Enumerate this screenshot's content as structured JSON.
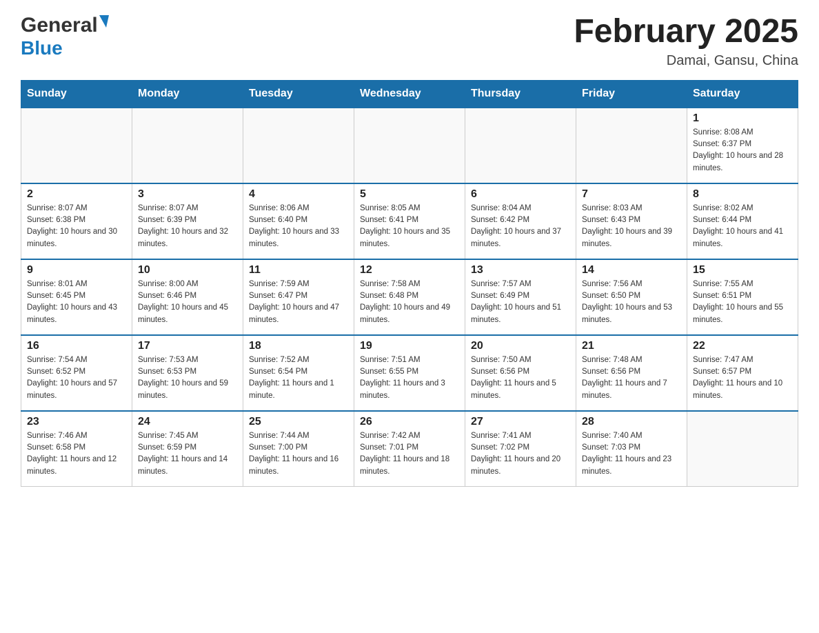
{
  "header": {
    "month_title": "February 2025",
    "location": "Damai, Gansu, China",
    "logo_general": "General",
    "logo_blue": "Blue"
  },
  "days_of_week": [
    "Sunday",
    "Monday",
    "Tuesday",
    "Wednesday",
    "Thursday",
    "Friday",
    "Saturday"
  ],
  "weeks": [
    {
      "days": [
        {
          "date": "",
          "sunrise": "",
          "sunset": "",
          "daylight": "",
          "empty": true
        },
        {
          "date": "",
          "sunrise": "",
          "sunset": "",
          "daylight": "",
          "empty": true
        },
        {
          "date": "",
          "sunrise": "",
          "sunset": "",
          "daylight": "",
          "empty": true
        },
        {
          "date": "",
          "sunrise": "",
          "sunset": "",
          "daylight": "",
          "empty": true
        },
        {
          "date": "",
          "sunrise": "",
          "sunset": "",
          "daylight": "",
          "empty": true
        },
        {
          "date": "",
          "sunrise": "",
          "sunset": "",
          "daylight": "",
          "empty": true
        },
        {
          "date": "1",
          "sunrise": "Sunrise: 8:08 AM",
          "sunset": "Sunset: 6:37 PM",
          "daylight": "Daylight: 10 hours and 28 minutes.",
          "empty": false
        }
      ]
    },
    {
      "days": [
        {
          "date": "2",
          "sunrise": "Sunrise: 8:07 AM",
          "sunset": "Sunset: 6:38 PM",
          "daylight": "Daylight: 10 hours and 30 minutes.",
          "empty": false
        },
        {
          "date": "3",
          "sunrise": "Sunrise: 8:07 AM",
          "sunset": "Sunset: 6:39 PM",
          "daylight": "Daylight: 10 hours and 32 minutes.",
          "empty": false
        },
        {
          "date": "4",
          "sunrise": "Sunrise: 8:06 AM",
          "sunset": "Sunset: 6:40 PM",
          "daylight": "Daylight: 10 hours and 33 minutes.",
          "empty": false
        },
        {
          "date": "5",
          "sunrise": "Sunrise: 8:05 AM",
          "sunset": "Sunset: 6:41 PM",
          "daylight": "Daylight: 10 hours and 35 minutes.",
          "empty": false
        },
        {
          "date": "6",
          "sunrise": "Sunrise: 8:04 AM",
          "sunset": "Sunset: 6:42 PM",
          "daylight": "Daylight: 10 hours and 37 minutes.",
          "empty": false
        },
        {
          "date": "7",
          "sunrise": "Sunrise: 8:03 AM",
          "sunset": "Sunset: 6:43 PM",
          "daylight": "Daylight: 10 hours and 39 minutes.",
          "empty": false
        },
        {
          "date": "8",
          "sunrise": "Sunrise: 8:02 AM",
          "sunset": "Sunset: 6:44 PM",
          "daylight": "Daylight: 10 hours and 41 minutes.",
          "empty": false
        }
      ]
    },
    {
      "days": [
        {
          "date": "9",
          "sunrise": "Sunrise: 8:01 AM",
          "sunset": "Sunset: 6:45 PM",
          "daylight": "Daylight: 10 hours and 43 minutes.",
          "empty": false
        },
        {
          "date": "10",
          "sunrise": "Sunrise: 8:00 AM",
          "sunset": "Sunset: 6:46 PM",
          "daylight": "Daylight: 10 hours and 45 minutes.",
          "empty": false
        },
        {
          "date": "11",
          "sunrise": "Sunrise: 7:59 AM",
          "sunset": "Sunset: 6:47 PM",
          "daylight": "Daylight: 10 hours and 47 minutes.",
          "empty": false
        },
        {
          "date": "12",
          "sunrise": "Sunrise: 7:58 AM",
          "sunset": "Sunset: 6:48 PM",
          "daylight": "Daylight: 10 hours and 49 minutes.",
          "empty": false
        },
        {
          "date": "13",
          "sunrise": "Sunrise: 7:57 AM",
          "sunset": "Sunset: 6:49 PM",
          "daylight": "Daylight: 10 hours and 51 minutes.",
          "empty": false
        },
        {
          "date": "14",
          "sunrise": "Sunrise: 7:56 AM",
          "sunset": "Sunset: 6:50 PM",
          "daylight": "Daylight: 10 hours and 53 minutes.",
          "empty": false
        },
        {
          "date": "15",
          "sunrise": "Sunrise: 7:55 AM",
          "sunset": "Sunset: 6:51 PM",
          "daylight": "Daylight: 10 hours and 55 minutes.",
          "empty": false
        }
      ]
    },
    {
      "days": [
        {
          "date": "16",
          "sunrise": "Sunrise: 7:54 AM",
          "sunset": "Sunset: 6:52 PM",
          "daylight": "Daylight: 10 hours and 57 minutes.",
          "empty": false
        },
        {
          "date": "17",
          "sunrise": "Sunrise: 7:53 AM",
          "sunset": "Sunset: 6:53 PM",
          "daylight": "Daylight: 10 hours and 59 minutes.",
          "empty": false
        },
        {
          "date": "18",
          "sunrise": "Sunrise: 7:52 AM",
          "sunset": "Sunset: 6:54 PM",
          "daylight": "Daylight: 11 hours and 1 minute.",
          "empty": false
        },
        {
          "date": "19",
          "sunrise": "Sunrise: 7:51 AM",
          "sunset": "Sunset: 6:55 PM",
          "daylight": "Daylight: 11 hours and 3 minutes.",
          "empty": false
        },
        {
          "date": "20",
          "sunrise": "Sunrise: 7:50 AM",
          "sunset": "Sunset: 6:56 PM",
          "daylight": "Daylight: 11 hours and 5 minutes.",
          "empty": false
        },
        {
          "date": "21",
          "sunrise": "Sunrise: 7:48 AM",
          "sunset": "Sunset: 6:56 PM",
          "daylight": "Daylight: 11 hours and 7 minutes.",
          "empty": false
        },
        {
          "date": "22",
          "sunrise": "Sunrise: 7:47 AM",
          "sunset": "Sunset: 6:57 PM",
          "daylight": "Daylight: 11 hours and 10 minutes.",
          "empty": false
        }
      ]
    },
    {
      "days": [
        {
          "date": "23",
          "sunrise": "Sunrise: 7:46 AM",
          "sunset": "Sunset: 6:58 PM",
          "daylight": "Daylight: 11 hours and 12 minutes.",
          "empty": false
        },
        {
          "date": "24",
          "sunrise": "Sunrise: 7:45 AM",
          "sunset": "Sunset: 6:59 PM",
          "daylight": "Daylight: 11 hours and 14 minutes.",
          "empty": false
        },
        {
          "date": "25",
          "sunrise": "Sunrise: 7:44 AM",
          "sunset": "Sunset: 7:00 PM",
          "daylight": "Daylight: 11 hours and 16 minutes.",
          "empty": false
        },
        {
          "date": "26",
          "sunrise": "Sunrise: 7:42 AM",
          "sunset": "Sunset: 7:01 PM",
          "daylight": "Daylight: 11 hours and 18 minutes.",
          "empty": false
        },
        {
          "date": "27",
          "sunrise": "Sunrise: 7:41 AM",
          "sunset": "Sunset: 7:02 PM",
          "daylight": "Daylight: 11 hours and 20 minutes.",
          "empty": false
        },
        {
          "date": "28",
          "sunrise": "Sunrise: 7:40 AM",
          "sunset": "Sunset: 7:03 PM",
          "daylight": "Daylight: 11 hours and 23 minutes.",
          "empty": false
        },
        {
          "date": "",
          "sunrise": "",
          "sunset": "",
          "daylight": "",
          "empty": true
        }
      ]
    }
  ]
}
